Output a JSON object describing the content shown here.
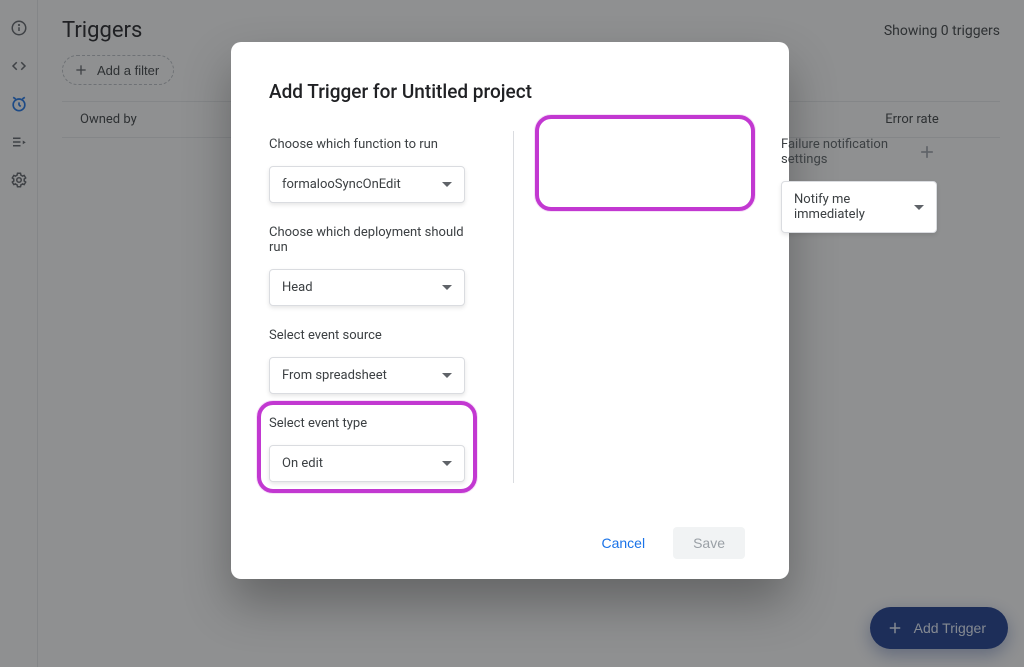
{
  "page": {
    "title": "Triggers",
    "showing_text": "Showing 0 triggers",
    "filter_chip_label": "Add a filter",
    "table": {
      "col_owned": "Owned by",
      "col_error": "Error rate"
    },
    "fab_label": "Add Trigger"
  },
  "dialog": {
    "title": "Add Trigger for Untitled project",
    "left": {
      "function": {
        "label": "Choose which function to run",
        "value": "formalooSyncOnEdit"
      },
      "deployment": {
        "label": "Choose which deployment should run",
        "value": "Head"
      },
      "event_source": {
        "label": "Select event source",
        "value": "From spreadsheet"
      },
      "event_type": {
        "label": "Select event type",
        "value": "On edit"
      }
    },
    "right": {
      "notif": {
        "label": "Failure notification settings",
        "value": "Notify me immediately"
      }
    },
    "actions": {
      "cancel": "Cancel",
      "save": "Save"
    }
  },
  "nav_icons": [
    "info-icon",
    "code-icon",
    "alarm-icon",
    "executions-icon",
    "gear-icon"
  ]
}
